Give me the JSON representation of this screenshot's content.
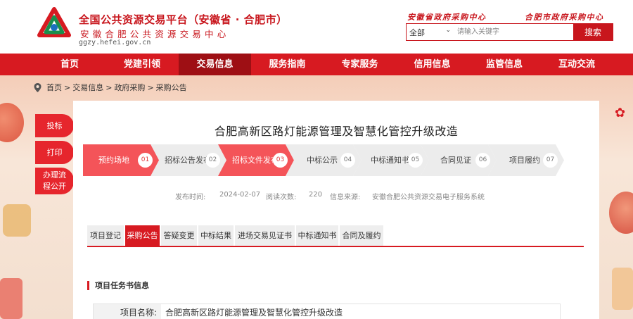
{
  "header": {
    "site_title": "全国公共资源交易平台（安徽省 · 合肥市）",
    "site_subtitle": "安徽合肥公共资源交易中心",
    "site_url": "ggzy.hefei.gov.cn",
    "province_center_link": "安徽省政府采购中心",
    "city_center_link": "合肥市政府采购中心",
    "search": {
      "selected": "全部",
      "placeholder": "请输入关键字",
      "button": "搜索"
    }
  },
  "nav": {
    "items": [
      {
        "label": "首页"
      },
      {
        "label": "党建引领"
      },
      {
        "label": "交易信息"
      },
      {
        "label": "服务指南"
      },
      {
        "label": "专家服务"
      },
      {
        "label": "信用信息"
      },
      {
        "label": "监管信息"
      },
      {
        "label": "互动交流"
      }
    ],
    "active_index": 2
  },
  "breadcrumb": [
    "首页",
    "交易信息",
    "政府采购",
    "采购公告"
  ],
  "side_tools": {
    "bid": "投标",
    "print": "打印",
    "process_line1": "办理流",
    "process_line2": "程公开"
  },
  "main": {
    "title": "合肥高新区路灯能源管理及智慧化管控升级改造",
    "steps": [
      {
        "label": "预约场地",
        "num": "01",
        "done": true
      },
      {
        "label": "招标公告发布",
        "num": "02",
        "done": false
      },
      {
        "label": "招标文件发布",
        "num": "03",
        "done": true
      },
      {
        "label": "中标公示",
        "num": "04",
        "done": false
      },
      {
        "label": "中标通知书",
        "num": "05",
        "done": false
      },
      {
        "label": "合同见证",
        "num": "06",
        "done": false
      },
      {
        "label": "项目履约",
        "num": "07",
        "done": false
      }
    ],
    "meta": {
      "publish_label": "发布时间:",
      "publish_date": "2024-02-07",
      "views_label": "阅读次数:",
      "views": "220",
      "source_label": "信息来源:",
      "source": "安徽合肥公共资源交易电子服务系统"
    },
    "tabs": [
      {
        "label": "项目登记"
      },
      {
        "label": "采购公告"
      },
      {
        "label": "答疑变更"
      },
      {
        "label": "中标结果"
      },
      {
        "label": "进场交易见证书"
      },
      {
        "label": "中标通知书"
      },
      {
        "label": "合同及履约"
      }
    ],
    "active_tab": 1,
    "section_title": "项目任务书信息",
    "fields": [
      {
        "label": "项目名称:",
        "value": "合肥高新区路灯能源管理及智慧化管控升级改造"
      }
    ]
  },
  "colors": {
    "brand_red": "#d71a21",
    "nav_active": "#9e0f14",
    "step_done": "#f45459",
    "step_pending": "#ececec"
  }
}
